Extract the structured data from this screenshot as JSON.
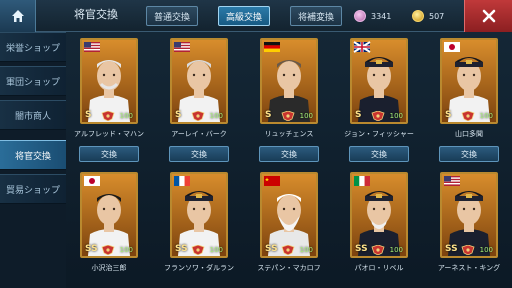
{
  "header": {
    "title": "将官交換",
    "tabs": [
      {
        "label": "普通交換",
        "active": false
      },
      {
        "label": "高級交換",
        "active": true
      },
      {
        "label": "将補変換",
        "active": false
      }
    ],
    "currencies": [
      {
        "icon": "gem-icon",
        "value": "3341"
      },
      {
        "icon": "gold-coin-icon",
        "value": "507"
      }
    ]
  },
  "sidebar": {
    "items": [
      {
        "label": "栄誉ショップ",
        "active": false
      },
      {
        "label": "軍団ショップ",
        "active": false
      },
      {
        "label": "闇市商人",
        "active": false
      },
      {
        "label": "将官交換",
        "active": true
      },
      {
        "label": "貿易ショップ",
        "active": false
      }
    ]
  },
  "officers": [
    {
      "name": "アルフレッド・マハン",
      "rank": "S",
      "level": "100",
      "flag": "usa",
      "exchange": "交換"
    },
    {
      "name": "アーレイ・バーク",
      "rank": "S",
      "level": "100",
      "flag": "usa",
      "exchange": "交換"
    },
    {
      "name": "リュッチェンス",
      "rank": "S",
      "level": "100",
      "flag": "germany",
      "exchange": "交換"
    },
    {
      "name": "ジョン・フィッシャー",
      "rank": "S",
      "level": "100",
      "flag": "uk",
      "exchange": "交換"
    },
    {
      "name": "山口多聞",
      "rank": "S",
      "level": "100",
      "flag": "japan",
      "exchange": "交換"
    },
    {
      "name": "小沢治三郎",
      "rank": "SS",
      "level": "100",
      "flag": "japan",
      "exchange": ""
    },
    {
      "name": "フランソワ・ダルラン",
      "rank": "SS",
      "level": "100",
      "flag": "france",
      "exchange": ""
    },
    {
      "name": "ステパン・マカロフ",
      "rank": "SS",
      "level": "100",
      "flag": "ussr",
      "exchange": ""
    },
    {
      "name": "パオロ・リベル",
      "rank": "SS",
      "level": "100",
      "flag": "italy",
      "exchange": ""
    },
    {
      "name": "アーネスト・キング",
      "rank": "SS",
      "level": "100",
      "flag": "usa",
      "exchange": ""
    }
  ],
  "colors": {
    "accent": "#2b7aa8",
    "close": "#c0393a",
    "card_gold": "#b9892f"
  }
}
